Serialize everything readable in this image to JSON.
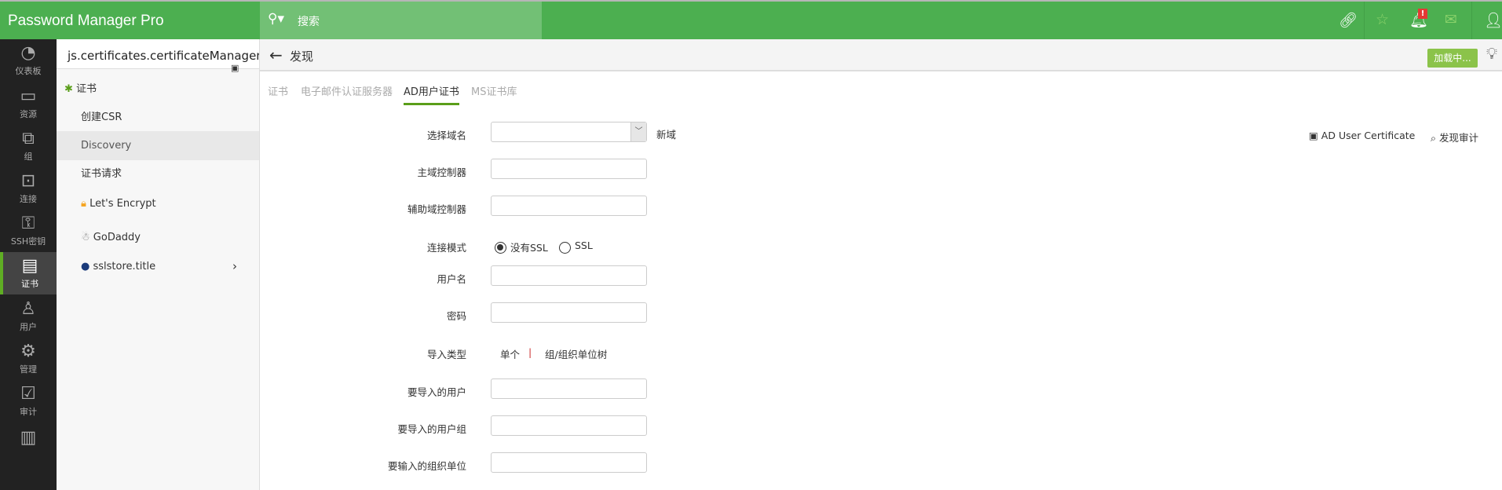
{
  "header": {
    "logo": "Password Manager Pro",
    "search_placeholder": "搜索",
    "alert_badge": "!"
  },
  "leftnav": [
    {
      "icon": "dashboard-icon",
      "label": "仪表板"
    },
    {
      "icon": "monitor-icon",
      "label": "资源"
    },
    {
      "icon": "group-icon",
      "label": "组"
    },
    {
      "icon": "connection-icon",
      "label": "连接"
    },
    {
      "icon": "ssh-key-icon",
      "label": "SSH密钥"
    },
    {
      "icon": "certificate-icon",
      "label": "证书",
      "active": true
    },
    {
      "icon": "user-icon",
      "label": "用户"
    },
    {
      "icon": "gear-icon",
      "label": "管理"
    },
    {
      "icon": "audit-icon",
      "label": "审计"
    },
    {
      "icon": "chart-icon",
      "label": ""
    }
  ],
  "panel": {
    "title": "js.certificates.certificateManageme",
    "items": [
      {
        "label": "证书"
      },
      {
        "label": "创建CSR"
      },
      {
        "label": "Discovery",
        "selected": true
      },
      {
        "label": "证书请求"
      },
      {
        "label": "Let's Encrypt"
      },
      {
        "label": "GoDaddy"
      },
      {
        "label": "sslstore.title"
      }
    ]
  },
  "page": {
    "title": "发现",
    "loading_button": "加载中...",
    "tabs": [
      "证书",
      "电子邮件认证服务器",
      "AD用户证书",
      "MS证书库"
    ],
    "active_tab": 2,
    "links": {
      "ad_user_cert": "AD User Certificate",
      "discovery_audit": "发现审计"
    }
  },
  "form": {
    "domain_label": "选择域名",
    "domain_value": "",
    "new_domain": "新域",
    "primary_dc_label": "主域控制器",
    "secondary_dc_label": "辅助域控制器",
    "conn_mode_label": "连接模式",
    "conn_options": [
      "没有SSL",
      "SSL"
    ],
    "conn_selected": 0,
    "username_label": "用户名",
    "password_label": "密码",
    "import_type_label": "导入类型",
    "import_single": "单个",
    "import_sep": "|",
    "import_tree": "组/组织单位树",
    "users_label": "要导入的用户",
    "groups_label": "要导入的用户组",
    "ou_label": "要输入的组织单位"
  }
}
